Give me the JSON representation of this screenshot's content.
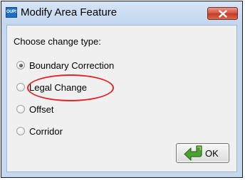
{
  "window": {
    "title": "Modify Area Feature",
    "app_icon_text": "OUPS",
    "close_label": "Close"
  },
  "dialog": {
    "prompt": "Choose change type:",
    "options": [
      {
        "label": "Boundary Correction",
        "checked": true
      },
      {
        "label": "Legal Change",
        "checked": false,
        "highlighted": true
      },
      {
        "label": "Offset",
        "checked": false
      },
      {
        "label": "Corridor",
        "checked": false
      }
    ],
    "ok_label": "OK"
  },
  "colors": {
    "title_bar": "#c5d8ef",
    "client_background": "#f0f0f0",
    "close_button": "#c94430",
    "highlight_ellipse": "#e32222",
    "ok_arrow": "#4f9f33"
  },
  "icons": {
    "app": "app-icon",
    "close": "close-icon",
    "ok": "ok-arrow-icon"
  }
}
